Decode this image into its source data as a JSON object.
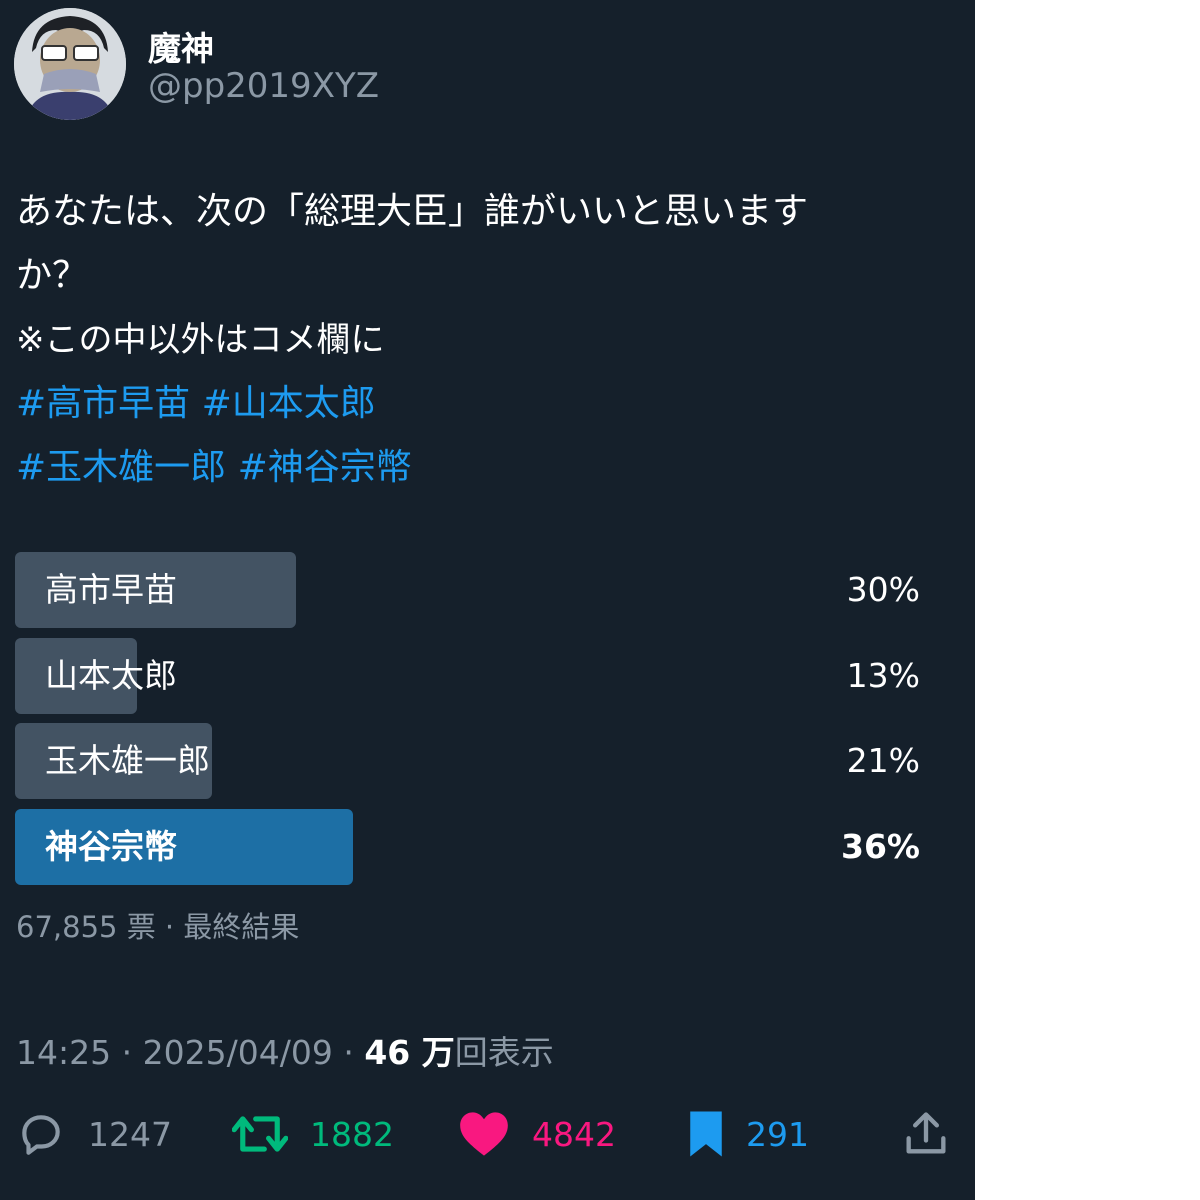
{
  "author": {
    "display_name": "魔神",
    "handle": "@pp2019XYZ"
  },
  "tweet": {
    "line1": "あなたは、次の「総理大臣」誰がいいと思います",
    "line2": "か？",
    "line3": "※この中以外はコメ欄に",
    "hashtags_line1": [
      "#高市早苗",
      "#山本太郎"
    ],
    "hashtags_line2": [
      "#玉木雄一郎",
      "#神谷宗幣"
    ]
  },
  "poll": {
    "options": [
      {
        "label": "高市早苗",
        "percent": "30%",
        "fraction": 0.3,
        "winner": false
      },
      {
        "label": "山本太郎",
        "percent": "13%",
        "fraction": 0.13,
        "winner": false
      },
      {
        "label": "玉木雄一郎",
        "percent": "21%",
        "fraction": 0.21,
        "winner": false
      },
      {
        "label": "神谷宗幣",
        "percent": "36%",
        "fraction": 0.36,
        "winner": true
      }
    ],
    "votes": "67,855 票",
    "separator": "·",
    "status": "最終結果"
  },
  "meta": {
    "time": "14:25",
    "date": "2025/04/09",
    "separator": "·",
    "views_count": "46 万",
    "views_label": "回表示"
  },
  "actions": {
    "replies": "1247",
    "retweets": "1882",
    "likes": "4842",
    "bookmarks": "291"
  },
  "colors": {
    "background": "#15202b",
    "hashtag": "#1d9bf0",
    "poll_bar": "#435363",
    "poll_winner": "#1d6fa5",
    "retweet": "#00ba7c",
    "like": "#f91880",
    "bookmark": "#1d9bf0",
    "muted": "#8b98a5"
  },
  "icons": [
    "avatar",
    "reply-icon",
    "retweet-icon",
    "like-icon",
    "bookmark-icon",
    "share-icon"
  ]
}
